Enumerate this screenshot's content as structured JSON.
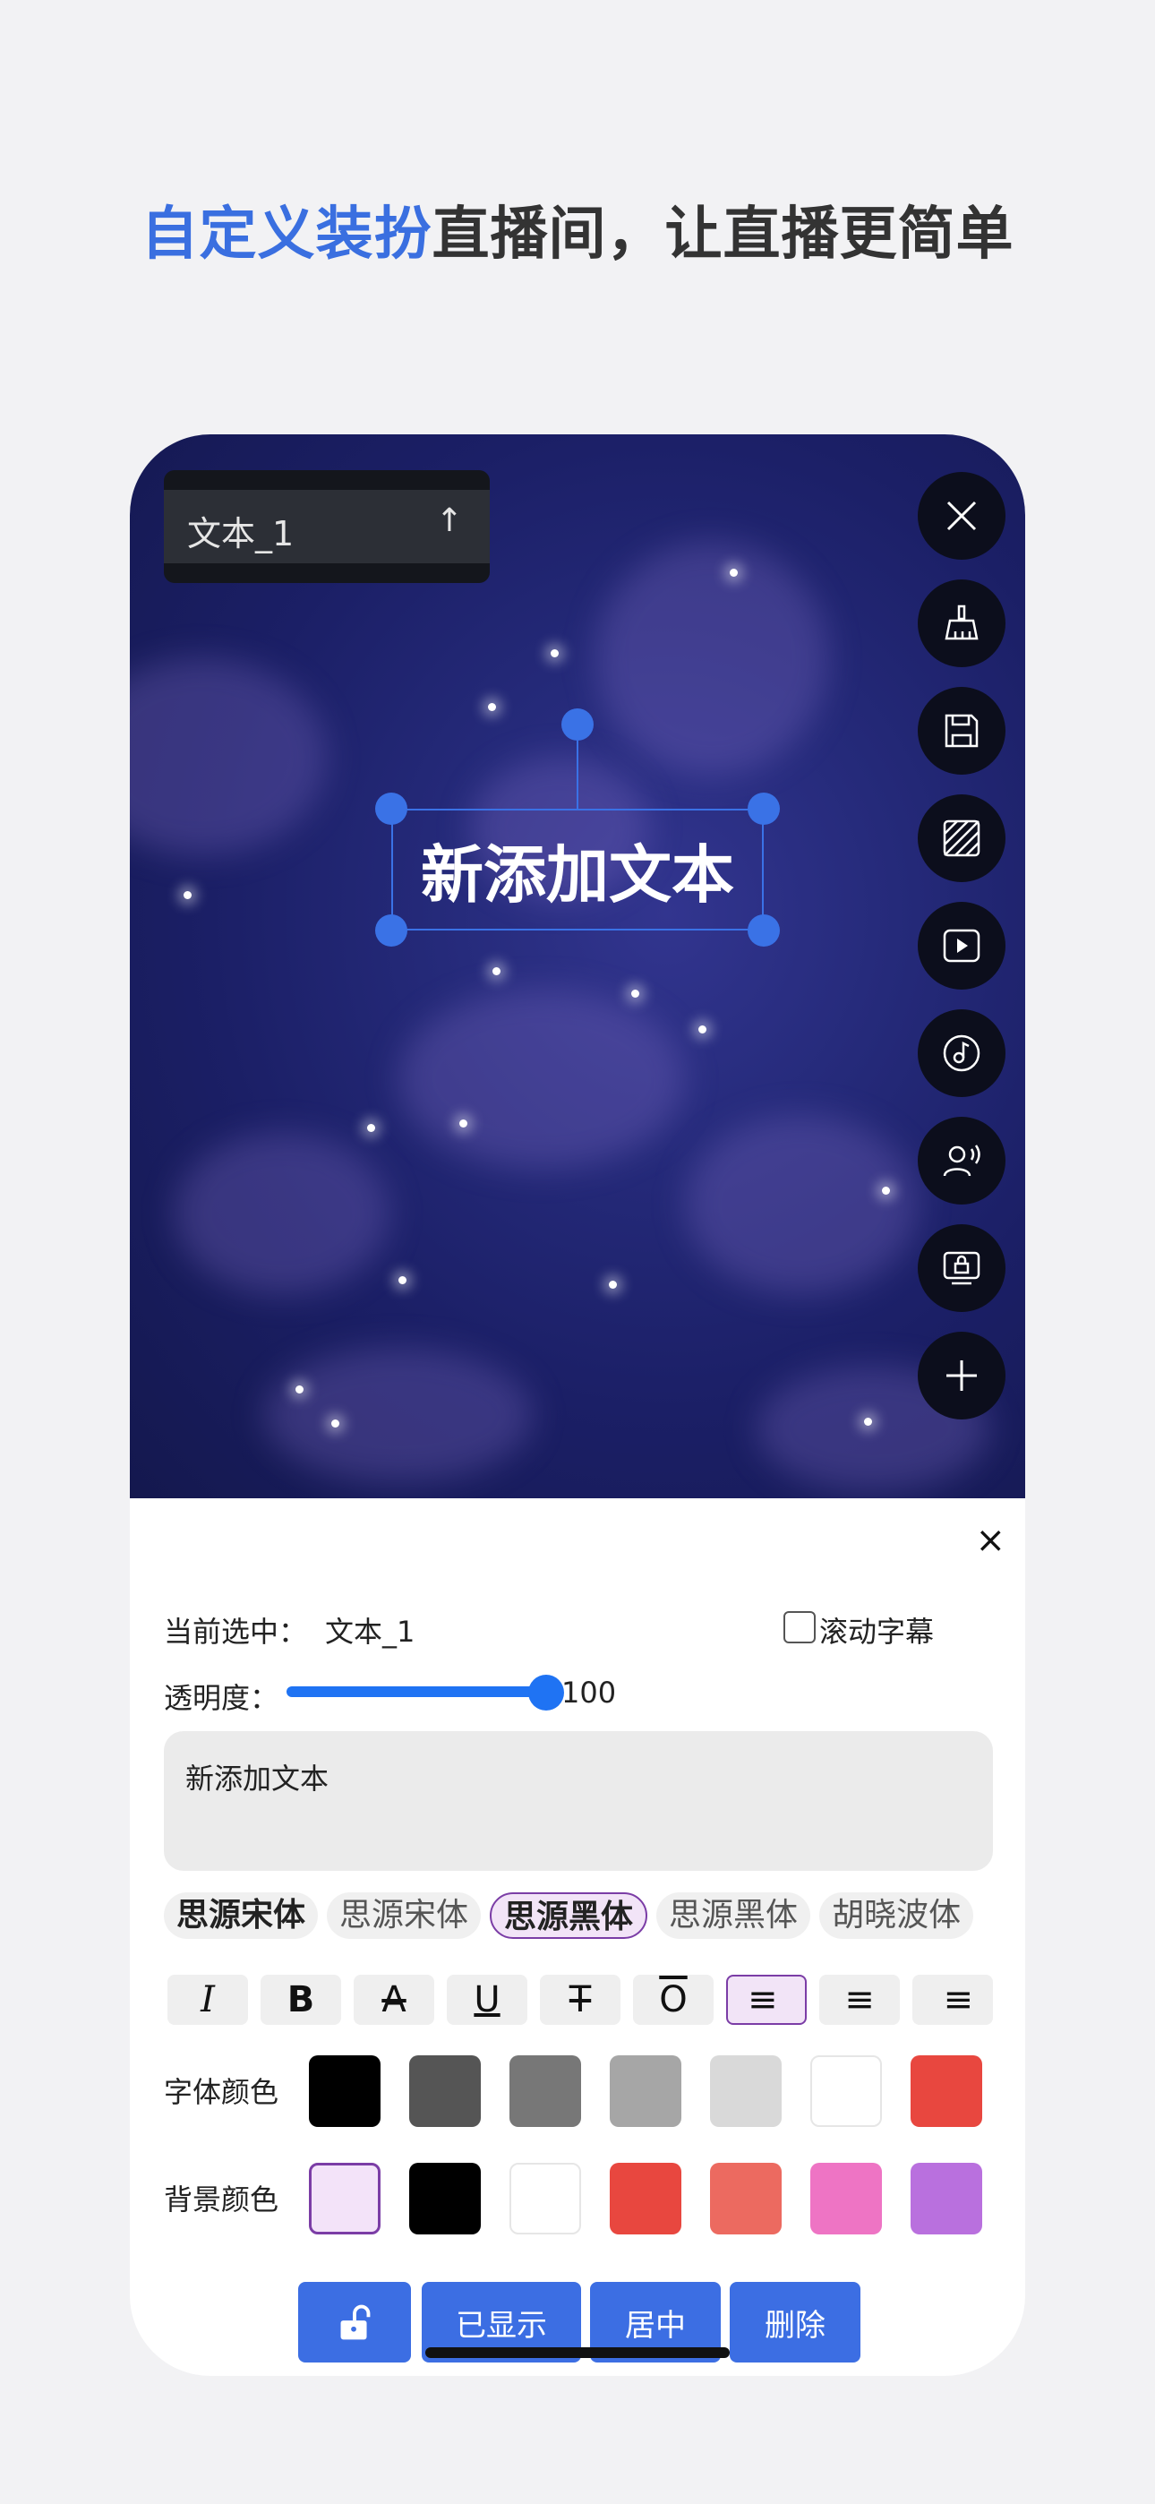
{
  "headline": {
    "highlight": "自定义装扮",
    "rest": "直播间，让直播更简单"
  },
  "layer": {
    "name": "文本_1",
    "arrow": "↑"
  },
  "toolbar": [
    "close-icon",
    "broom-icon",
    "save-icon",
    "hatch-pattern-icon",
    "play-icon",
    "music-note-icon",
    "voice-user-icon",
    "locked-screen-icon",
    "plus-icon"
  ],
  "canvas_text": "新添加文本",
  "panel": {
    "close": "×",
    "selected_label": "当前选中：",
    "selected_value": "文本_1",
    "scroll_label": "滚动字幕",
    "opacity_label": "透明度：",
    "opacity_value": "100",
    "opacity_fraction": 1.0,
    "text_value": "新添加文本",
    "fonts": [
      {
        "label": "思源宋体",
        "style": "bold"
      },
      {
        "label": "思源宋体",
        "style": "normal"
      },
      {
        "label": "思源黑体",
        "style": "selected"
      },
      {
        "label": "思源黑体",
        "style": "normal"
      },
      {
        "label": "胡晓波体",
        "style": "normal"
      }
    ],
    "style_buttons": [
      {
        "glyph": "I",
        "name": "italic-icon"
      },
      {
        "glyph": "B",
        "name": "bold-icon"
      },
      {
        "glyph": "A",
        "name": "strike-a-icon"
      },
      {
        "glyph": "U",
        "name": "underline-icon"
      },
      {
        "glyph": "T",
        "name": "strikethrough-icon"
      },
      {
        "glyph": "O",
        "name": "overline-icon"
      },
      {
        "glyph": "≡",
        "name": "align-left-icon"
      },
      {
        "glyph": "≡",
        "name": "align-center-icon"
      },
      {
        "glyph": "≡",
        "name": "align-right-icon"
      }
    ],
    "font_color_label": "字体颜色",
    "font_colors": [
      "#000000",
      "#555555",
      "#777777",
      "#a6a6a6",
      "#d9d9d9",
      "#ffffff",
      "#e8473f"
    ],
    "bg_color_label": "背景颜色",
    "bg_colors": [
      "#f3e3f9",
      "#000000",
      "#ffffff",
      "#e8473f",
      "#ec6a60",
      "#ee74c4",
      "#b970de"
    ],
    "actions": {
      "shown": "已显示",
      "center": "居中",
      "delete": "删除"
    }
  }
}
